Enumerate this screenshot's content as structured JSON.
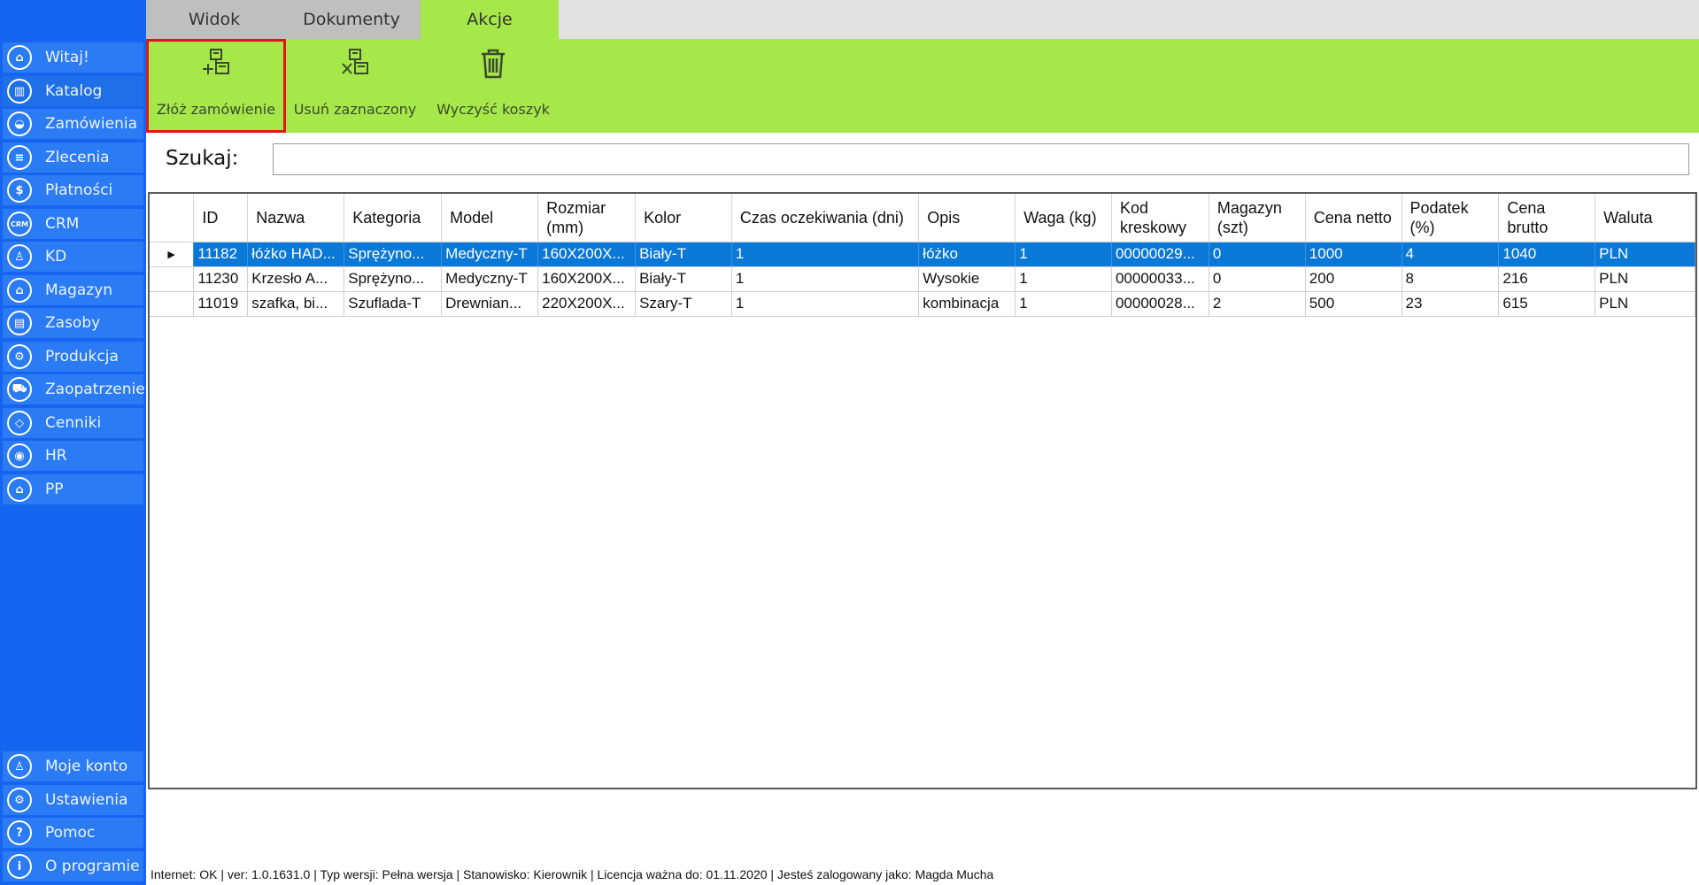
{
  "sidebar": {
    "items": [
      {
        "label": "Witaj!",
        "icon": "home-icon",
        "glyph": "⌂"
      },
      {
        "label": "Katalog",
        "icon": "book-icon",
        "glyph": "▥",
        "active": true
      },
      {
        "label": "Zamówienia",
        "icon": "cart-icon",
        "glyph": "◒"
      },
      {
        "label": "Zlecenia",
        "icon": "list-icon",
        "glyph": "≡"
      },
      {
        "label": "Płatności",
        "icon": "dollar-icon",
        "glyph": "$"
      },
      {
        "label": "CRM",
        "icon": "crm-icon",
        "glyph": "CRM"
      },
      {
        "label": "KD",
        "icon": "user-icon",
        "glyph": "♙"
      },
      {
        "label": "Magazyn",
        "icon": "warehouse-icon",
        "glyph": "⌂"
      },
      {
        "label": "Zasoby",
        "icon": "resources-icon",
        "glyph": "▤"
      },
      {
        "label": "Produkcja",
        "icon": "production-icon",
        "glyph": "⚙"
      },
      {
        "label": "Zaopatrzenie",
        "icon": "truck-icon",
        "glyph": "⛟"
      },
      {
        "label": "Cenniki",
        "icon": "tag-icon",
        "glyph": "◇"
      },
      {
        "label": "HR",
        "icon": "hr-icon",
        "glyph": "◉"
      },
      {
        "label": "PP",
        "icon": "factory-icon",
        "glyph": "⌂"
      }
    ],
    "bottom_items": [
      {
        "label": "Moje konto",
        "icon": "account-icon",
        "glyph": "♙"
      },
      {
        "label": "Ustawienia",
        "icon": "settings-icon",
        "glyph": "⚙"
      },
      {
        "label": "Pomoc",
        "icon": "help-icon",
        "glyph": "?"
      },
      {
        "label": "O programie",
        "icon": "info-icon",
        "glyph": "i"
      }
    ]
  },
  "tabs": [
    {
      "label": "Widok",
      "active": false
    },
    {
      "label": "Dokumenty",
      "active": false
    },
    {
      "label": "Akcje",
      "active": true
    }
  ],
  "ribbon": {
    "buttons": [
      {
        "label": "Złóż zamówienie",
        "icon": "place-order-icon",
        "highlighted": true
      },
      {
        "label": "Usuń zaznaczony",
        "icon": "remove-selected-icon",
        "highlighted": false
      },
      {
        "label": "Wyczyść koszyk",
        "icon": "trash-icon",
        "highlighted": false
      }
    ]
  },
  "search": {
    "label": "Szukaj:",
    "value": ""
  },
  "grid": {
    "columns": [
      "ID",
      "Nazwa",
      "Kategoria",
      "Model",
      "Rozmiar (mm)",
      "Kolor",
      "Czas oczekiwania (dni)",
      "Opis",
      "Waga (kg)",
      "Kod kreskowy",
      "Magazyn (szt)",
      "Cena netto",
      "Podatek (%)",
      "Cena brutto",
      "Waluta"
    ],
    "rows": [
      {
        "selected": true,
        "cells": [
          "11182",
          "łóżko HAD...",
          "Sprężyno...",
          "Medyczny-T",
          "160X200X...",
          "Biały-T",
          "1",
          "łóżko",
          "1",
          "00000029...",
          "0",
          "1000",
          "4",
          "1040",
          "PLN"
        ]
      },
      {
        "selected": false,
        "cells": [
          "11230",
          "Krzesło A...",
          "Sprężyno...",
          "Medyczny-T",
          "160X200X...",
          "Biały-T",
          "1",
          "Wysokie",
          "1",
          "00000033...",
          "0",
          "200",
          "8",
          "216",
          "PLN"
        ]
      },
      {
        "selected": false,
        "cells": [
          "11019",
          "szafka, bi...",
          "Szuflada-T",
          "Drewnian...",
          "220X200X...",
          "Szary-T",
          "1",
          "kombinacja",
          "1",
          "00000028...",
          "2",
          "500",
          "23",
          "615",
          "PLN"
        ]
      }
    ]
  },
  "statusbar": {
    "text": "Internet: OK  |   ver: 1.0.1631.0   |   Typ wersji: Pełna wersja   |   Stanowisko: Kierownik   |   Licencja ważna do: 01.11.2020   |   Jesteś zalogowany jako: Magda Mucha"
  },
  "colors": {
    "sidebar": "#1565f0",
    "sidebar_item": "#2b7bf4",
    "ribbon": "#a6e84a",
    "selection": "#0a78d7",
    "highlight_border": "#e0161b"
  }
}
